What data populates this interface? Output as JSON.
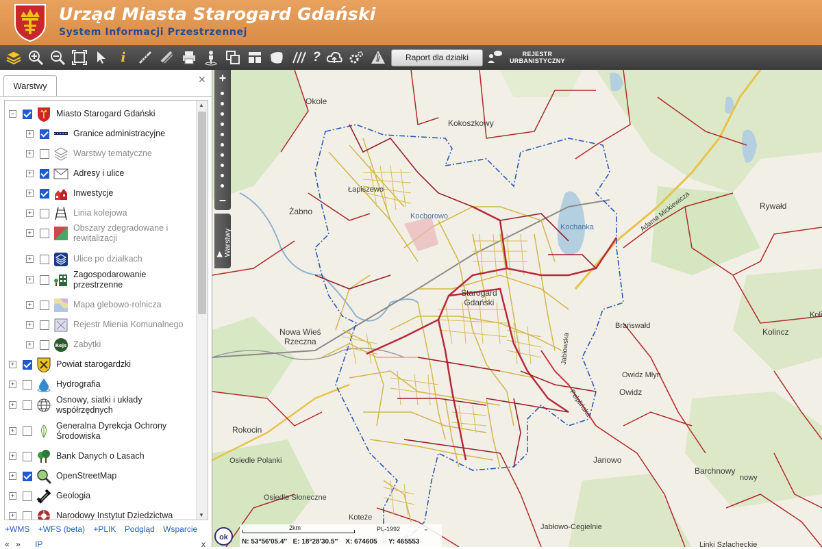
{
  "header": {
    "title": "Urząd Miasta Starogard Gdański",
    "subtitle": "System Informacji Przestrzennej"
  },
  "toolbar": {
    "icons": [
      "layers-icon",
      "zoom-in-icon",
      "zoom-out-icon",
      "zoom-extent-icon",
      "pointer-icon",
      "info-icon",
      "measure-distance-icon",
      "measure-area-icon",
      "print-icon",
      "street-view-icon",
      "copy-icon",
      "layout-icon",
      "shape-icon",
      "hatch-icon",
      "help-icon",
      "cloud-upload-icon",
      "settings-icon",
      "warning-icon"
    ],
    "raport_label": "Raport dla działki",
    "rejestr_line1": "REJESTR",
    "rejestr_line2": "URBANISTYCZNY"
  },
  "panel": {
    "tab_label": "Warstwy",
    "close": "✕",
    "layers": [
      {
        "label": "Miasto Starogard Gdański",
        "checked": true,
        "expander": "⊟",
        "icon": "crest-icon",
        "dim": false
      },
      {
        "label": "Granice administracyjne",
        "checked": true,
        "expander": "+",
        "icon": "boundary-line-icon",
        "dim": false
      },
      {
        "label": "Warstwy tematyczne",
        "checked": false,
        "expander": "+",
        "icon": "stacked-layers-icon",
        "dim": true
      },
      {
        "label": "Adresy i ulice",
        "checked": true,
        "expander": "+",
        "icon": "envelope-icon",
        "dim": false
      },
      {
        "label": "Inwestycje",
        "checked": true,
        "expander": "+",
        "icon": "buildings-icon",
        "dim": false
      },
      {
        "label": "Linia kolejowa",
        "checked": false,
        "expander": "+",
        "icon": "railway-icon",
        "dim": true
      },
      {
        "label": "Obszary zdegradowane i rewitalizacji",
        "checked": false,
        "expander": "+",
        "icon": "degraded-area-icon",
        "dim": true
      },
      {
        "label": "Ulice po działkach",
        "checked": false,
        "expander": "+",
        "icon": "layers-blue-icon",
        "dim": true
      },
      {
        "label": "Zagospodarowanie przestrzenne",
        "checked": false,
        "expander": "+",
        "icon": "zoning-icon",
        "dim": false
      },
      {
        "label": "Mapa glebowo-rolnicza",
        "checked": false,
        "expander": "+",
        "icon": "soil-map-icon",
        "dim": true
      },
      {
        "label": "Rejestr Mienia Komunalnego",
        "checked": false,
        "expander": "+",
        "icon": "municipal-property-icon",
        "dim": true
      },
      {
        "label": "Zabytki",
        "checked": false,
        "expander": "+",
        "icon": "monument-icon",
        "dim": true
      },
      {
        "label": "Powiat starogardzki",
        "checked": true,
        "expander": "+",
        "icon": "county-crest-icon",
        "dim": false
      },
      {
        "label": "Hydrografia",
        "checked": false,
        "expander": "+",
        "icon": "water-drop-icon",
        "dim": false
      },
      {
        "label": "Osnowy, siatki i układy współrzędnych",
        "checked": false,
        "expander": "+",
        "icon": "globe-grid-icon",
        "dim": false
      },
      {
        "label": "Generalna Dyrekcja Ochrony Środowiska",
        "checked": false,
        "expander": "+",
        "icon": "leaf-icon",
        "dim": false
      },
      {
        "label": "Bank Danych o Lasach",
        "checked": false,
        "expander": "+",
        "icon": "forest-icon",
        "dim": false
      },
      {
        "label": "OpenStreetMap",
        "checked": true,
        "expander": "+",
        "icon": "osm-magnifier-icon",
        "dim": false
      },
      {
        "label": "Geologia",
        "checked": false,
        "expander": "+",
        "icon": "hammers-icon",
        "dim": false
      },
      {
        "label": "Narodowy Instytut Dziedzictwa",
        "checked": false,
        "expander": "+",
        "icon": "heritage-icon",
        "dim": false
      }
    ],
    "links": [
      "+WMS",
      "+WFS (beta)",
      "+PLIK",
      "Podgląd",
      "Wsparcie"
    ],
    "links2": [
      "«",
      "»",
      "IP"
    ],
    "close_bottom": "x"
  },
  "map": {
    "side_tab": "Warstwy",
    "ok_label": "ok",
    "scale_label": "2km",
    "projection": "PL-1992",
    "projection_arrow": "⌄",
    "coords": {
      "n": "N: 53°56′05.4″",
      "e": "E: 18°28′30.5″",
      "x": "X: 674605",
      "y": "Y: 465553"
    },
    "labels": {
      "okole": "Okole",
      "kokoszkowy": "Kokoszkowy",
      "lapiszewo": "Łapiszewo",
      "kochanka": "Kochanka",
      "zabno": "Żabno",
      "kocborowo": "Kocborowo",
      "starogard1": "Starogard",
      "starogard2": "Gdański",
      "nowa_wies1": "Nowa Wieś",
      "nowa_wies2": "Rzeczna",
      "rywald": "Rywałd",
      "adama": "Adama Mickiewicza",
      "branzwald": "Brańswałd",
      "kolincz": "Kolincz",
      "koli": "Koli",
      "owidz_mlyn": "Owidz Młyn",
      "owidz": "Owidz",
      "jablowska": "Jabłowska",
      "pelplinska": "Pelplińska",
      "rokocin": "Rokocin",
      "osiedle_polanki": "Osiedle Polanki",
      "janowo": "Janowo",
      "barchnowy": "Barchnowy",
      "nowy": "nowy",
      "osiedle_sloneczne": "Osiedle Słoneczne",
      "koteze": "Koteże",
      "jablowo": "Jabłowo-Cegielnie",
      "linki": "Linki Szlacheckie"
    }
  }
}
